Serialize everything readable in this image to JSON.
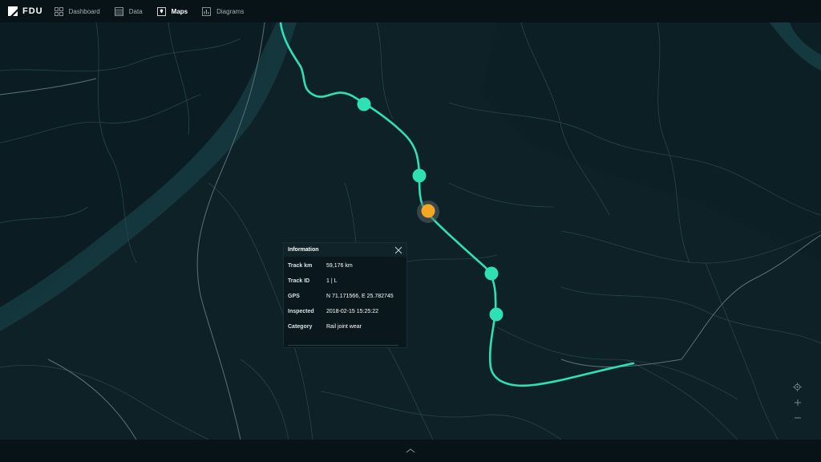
{
  "app": {
    "logo_text": "FDU"
  },
  "nav": [
    {
      "label": "Dashboard",
      "icon": "dashboard-grid-icon",
      "active": false
    },
    {
      "label": "Data",
      "icon": "data-table-icon",
      "active": false
    },
    {
      "label": "Maps",
      "icon": "map-pin-icon",
      "active": true
    },
    {
      "label": "Diagrams",
      "icon": "bar-chart-icon",
      "active": false
    }
  ],
  "info": {
    "title": "Information",
    "rows": [
      {
        "label": "Track km",
        "value": "59,176 km"
      },
      {
        "label": "Track ID",
        "value": "1 | L"
      },
      {
        "label": "GPS",
        "value": "N 71.171566, E 25.782745"
      },
      {
        "label": "Inspected",
        "value": "2018-02-15 15:25:22"
      },
      {
        "label": "Category",
        "value": "Rail joint wear"
      }
    ]
  },
  "map_controls": [
    "locate-icon",
    "zoom-in-icon",
    "zoom-out-icon"
  ],
  "colors": {
    "track": "#2fe0b5",
    "marker": "#2fe0b5",
    "selected_marker": "#f5a623",
    "background": "#0d2127"
  }
}
